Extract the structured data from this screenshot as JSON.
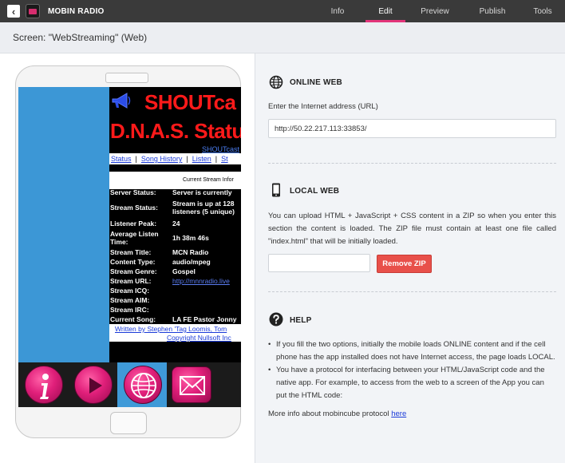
{
  "app": {
    "name": "MOBIN RADIO"
  },
  "tabs": [
    {
      "label": "Info",
      "active": false
    },
    {
      "label": "Edit",
      "active": true
    },
    {
      "label": "Preview",
      "active": false
    },
    {
      "label": "Publish",
      "active": false
    },
    {
      "label": "Tools",
      "active": false
    }
  ],
  "screen_label": "Screen: \"WebStreaming\" (Web)",
  "webview": {
    "title1": "SHOUTca",
    "title2": "D.N.A.S. Statu",
    "shoutcast_link": "SHOUTcast",
    "nav": [
      "Status",
      "Song History",
      "Listen",
      "St"
    ],
    "stream_info_title": "Current Stream Infor",
    "stats": [
      {
        "label": "Server Status:",
        "value": "Server is currently"
      },
      {
        "label": "Stream Status:",
        "value": "Stream is up at 128",
        "value2": "listeners (5 unique)"
      },
      {
        "label": "Listener Peak:",
        "value": "24"
      },
      {
        "label": "Average Listen",
        "label2": "Time:",
        "value": "1h 38m 46s"
      },
      {
        "label": "Stream Title:",
        "value": "MCN Radio"
      },
      {
        "label": "Content Type:",
        "value": "audio/mpeg"
      },
      {
        "label": "Stream Genre:",
        "value": "Gospel"
      },
      {
        "label": "Stream URL:",
        "value": "http://mnnradio.live"
      },
      {
        "label": "Stream ICQ:",
        "value": ""
      },
      {
        "label": "Stream AIM:",
        "value": ""
      },
      {
        "label": "Stream IRC:",
        "value": ""
      },
      {
        "label": "Current Song:",
        "value": "LA FE Pastor Jonny"
      }
    ],
    "credit1": "Written by Stephen 'Tag Loomis, Tom",
    "credit2": "Copyright Nullsoft Inc"
  },
  "bottom_icons": [
    "info-icon",
    "play-icon",
    "globe-icon",
    "mail-icon"
  ],
  "online_web": {
    "title": "ONLINE WEB",
    "label": "Enter the Internet address (URL)",
    "url": "http://50.22.217.113:33853/"
  },
  "local_web": {
    "title": "LOCAL WEB",
    "description": "You can upload HTML + JavaScript + CSS content in a ZIP so when you enter this section the content is loaded. The ZIP file must contain at least one file called \"index.html\" that will be initially loaded.",
    "remove_label": "Remove ZIP"
  },
  "help": {
    "title": "HELP",
    "bullets": [
      "If you fill the two options, initially the mobile loads ONLINE content and if the cell phone has the app installed does not have Internet access, the page loads LOCAL.",
      "You have a protocol for interfacing between your HTML/JavaScript code and the native app. For example, to access from the web to a screen of the App you can put the HTML code:"
    ],
    "more_text": "More info about mobincube protocol ",
    "more_link": "here"
  },
  "colors": {
    "accent": "#e2347a",
    "danger": "#e8504a",
    "topbar": "#3a3a3a",
    "selected_icon": "#3f9ad8",
    "shoutcast_red": "#ff1a1a"
  }
}
